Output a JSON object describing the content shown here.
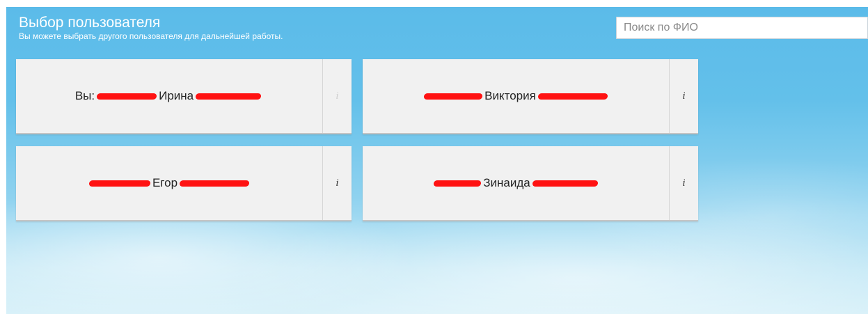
{
  "header": {
    "title": "Выбор пользователя",
    "subtitle": "Вы можете выбрать другого пользователя для дальнейшей работы."
  },
  "search": {
    "placeholder": "Поиск по ФИО",
    "value": ""
  },
  "users": [
    {
      "prefix": "Вы:",
      "first_name": "Ирина",
      "info_label": "i",
      "info_enabled": false
    },
    {
      "prefix": "",
      "first_name": "Виктория",
      "info_label": "i",
      "info_enabled": true
    },
    {
      "prefix": "",
      "first_name": "Егор",
      "info_label": "i",
      "info_enabled": true
    },
    {
      "prefix": "",
      "first_name": "Зинаида",
      "info_label": "i",
      "info_enabled": true
    }
  ],
  "colors": {
    "redaction": "#ff1212",
    "background_top": "#5bbbe9",
    "card": "#f1f1f1"
  }
}
